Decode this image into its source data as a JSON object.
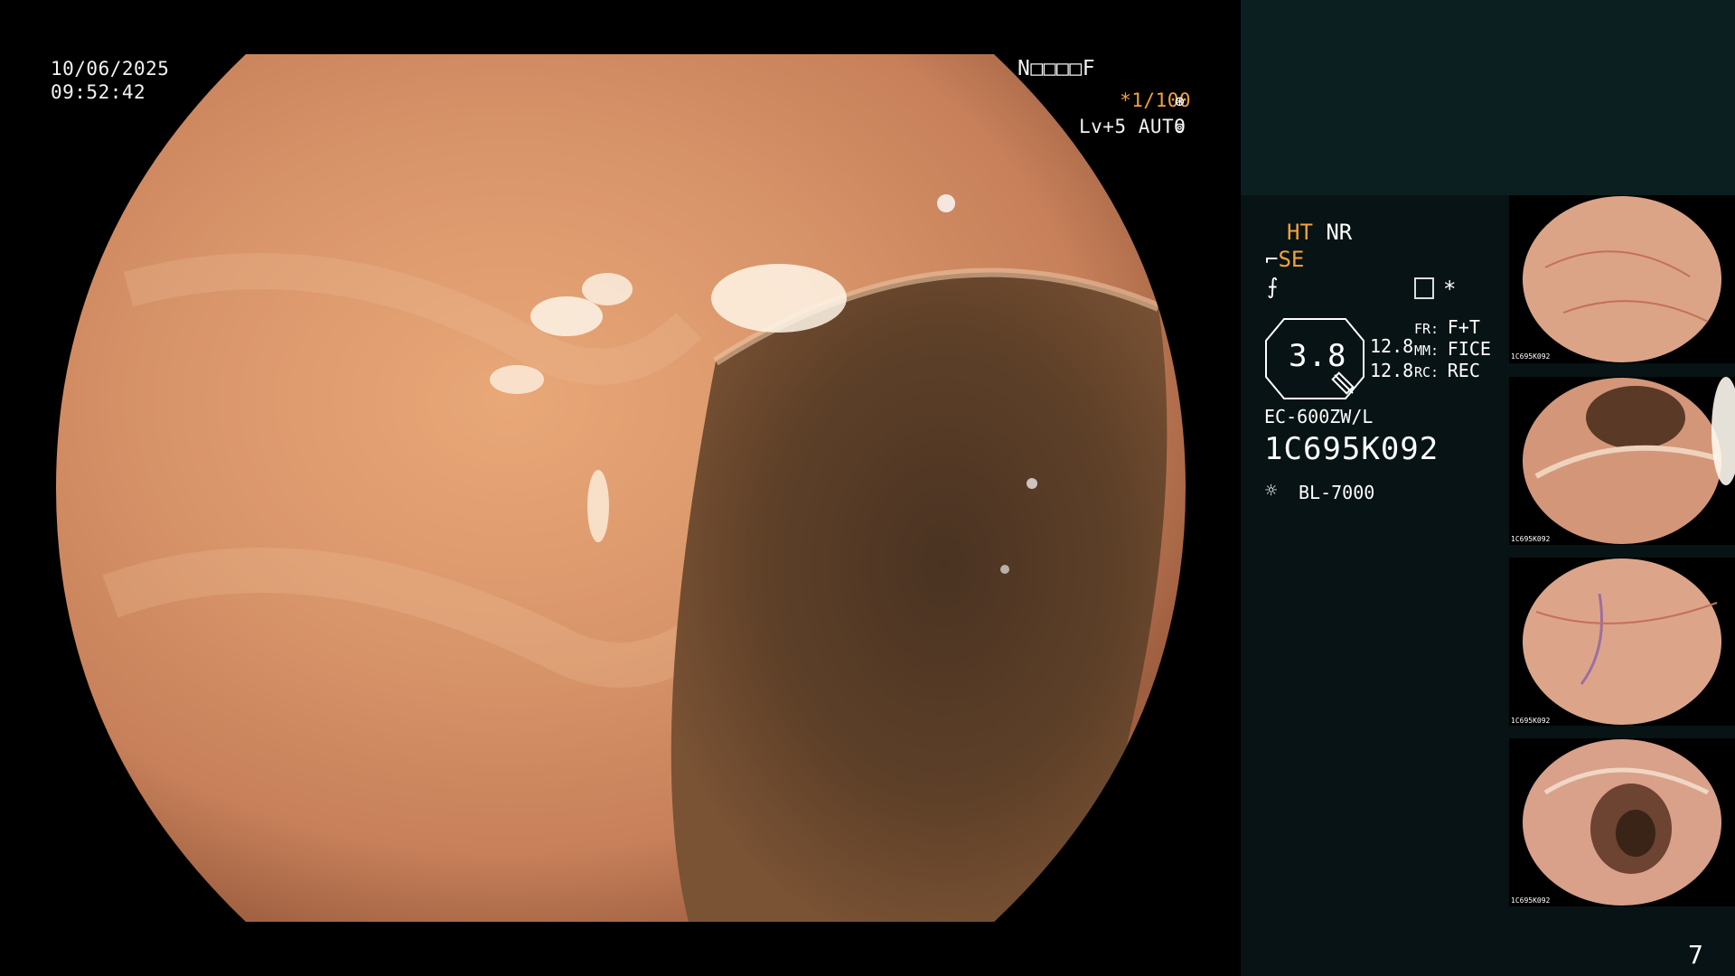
{
  "overlay": {
    "date": "10/06/2025",
    "time": "09:52:42",
    "patient_code": "N□□□□F",
    "shutter": "*1/100",
    "level": "Lv+5",
    "iris": "AUTO"
  },
  "settings": {
    "ht": "HT",
    "nr": "NR",
    "se": "SE",
    "zoom_value": "3.8",
    "val1": "12.8",
    "val2": "12.8",
    "fr_key": "FR:",
    "fr_val": "F+T",
    "mm_key": "MM:",
    "mm_val": "FICE",
    "rc_key": "RC:",
    "rc_val": "REC",
    "scope_model": "EC-600ZW/L",
    "scope_serial": "1C695K092",
    "light_source": "BL-7000",
    "asterisk": "*"
  },
  "thumbnails": [
    {
      "serial": "1C695K092"
    },
    {
      "serial": "1C695K092"
    },
    {
      "serial": "1C695K092"
    },
    {
      "serial": "1C695K092"
    }
  ],
  "page_number": "7",
  "colors": {
    "accent": "#f3a23a",
    "panel_bg": "#071314",
    "panel_top": "#0b1f20"
  }
}
